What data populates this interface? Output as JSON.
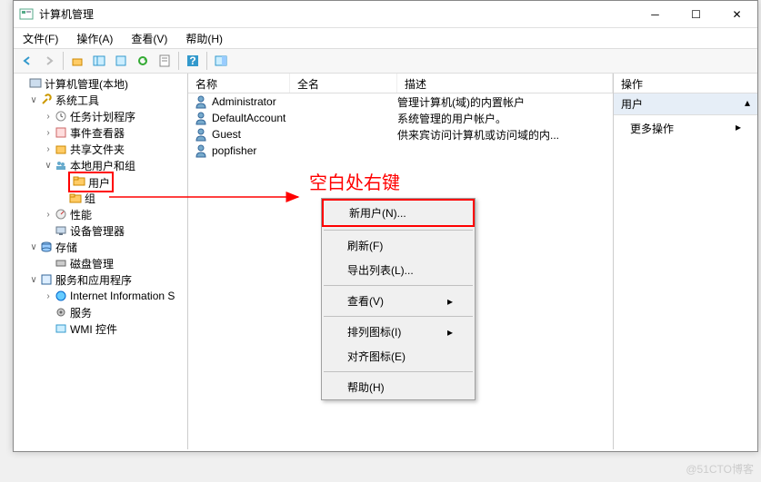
{
  "window": {
    "title": "计算机管理"
  },
  "menu": {
    "file": "文件(F)",
    "action": "操作(A)",
    "view": "查看(V)",
    "help": "帮助(H)"
  },
  "tree": {
    "root": "计算机管理(本地)",
    "systools": "系统工具",
    "tasksched": "任务计划程序",
    "eventvwr": "事件查看器",
    "shared": "共享文件夹",
    "lusrmgr": "本地用户和组",
    "users": "用户",
    "groups": "组",
    "perf": "性能",
    "devmgr": "设备管理器",
    "storage": "存储",
    "diskmgr": "磁盘管理",
    "services": "服务和应用程序",
    "iis": "Internet Information S",
    "svcs": "服务",
    "wmi": "WMI 控件"
  },
  "list": {
    "col_name": "名称",
    "col_full": "全名",
    "col_desc": "描述",
    "rows": [
      {
        "name": "Administrator",
        "full": "",
        "desc": "管理计算机(域)的内置帐户"
      },
      {
        "name": "DefaultAccount",
        "full": "",
        "desc": "系统管理的用户帐户。"
      },
      {
        "name": "Guest",
        "full": "",
        "desc": "供来宾访问计算机或访问域的内..."
      },
      {
        "name": "popfisher",
        "full": "",
        "desc": ""
      }
    ]
  },
  "actions": {
    "header": "操作",
    "category": "用户",
    "more": "更多操作"
  },
  "context": {
    "newuser": "新用户(N)...",
    "refresh": "刷新(F)",
    "export": "导出列表(L)...",
    "view": "查看(V)",
    "arrange": "排列图标(I)",
    "align": "对齐图标(E)",
    "help": "帮助(H)"
  },
  "annotation": "空白处右键",
  "watermark": "@51CTO博客"
}
